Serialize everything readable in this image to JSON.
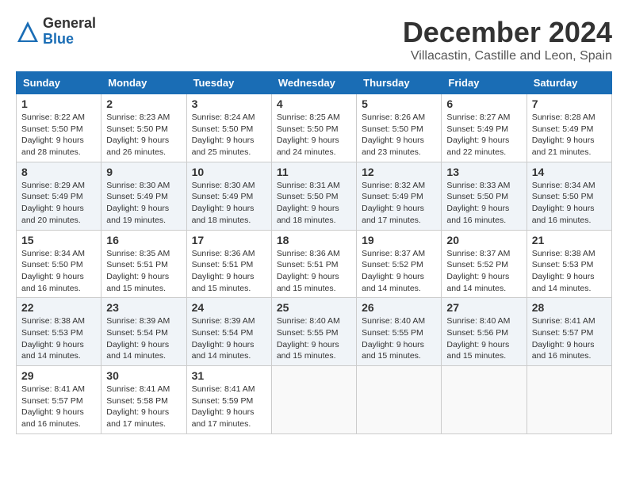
{
  "logo": {
    "general": "General",
    "blue": "Blue"
  },
  "title": "December 2024",
  "location": "Villacastin, Castille and Leon, Spain",
  "weekdays": [
    "Sunday",
    "Monday",
    "Tuesday",
    "Wednesday",
    "Thursday",
    "Friday",
    "Saturday"
  ],
  "weeks": [
    [
      {
        "day": "1",
        "info": "Sunrise: 8:22 AM\nSunset: 5:50 PM\nDaylight: 9 hours and 28 minutes."
      },
      {
        "day": "2",
        "info": "Sunrise: 8:23 AM\nSunset: 5:50 PM\nDaylight: 9 hours and 26 minutes."
      },
      {
        "day": "3",
        "info": "Sunrise: 8:24 AM\nSunset: 5:50 PM\nDaylight: 9 hours and 25 minutes."
      },
      {
        "day": "4",
        "info": "Sunrise: 8:25 AM\nSunset: 5:50 PM\nDaylight: 9 hours and 24 minutes."
      },
      {
        "day": "5",
        "info": "Sunrise: 8:26 AM\nSunset: 5:50 PM\nDaylight: 9 hours and 23 minutes."
      },
      {
        "day": "6",
        "info": "Sunrise: 8:27 AM\nSunset: 5:49 PM\nDaylight: 9 hours and 22 minutes."
      },
      {
        "day": "7",
        "info": "Sunrise: 8:28 AM\nSunset: 5:49 PM\nDaylight: 9 hours and 21 minutes."
      }
    ],
    [
      {
        "day": "8",
        "info": "Sunrise: 8:29 AM\nSunset: 5:49 PM\nDaylight: 9 hours and 20 minutes."
      },
      {
        "day": "9",
        "info": "Sunrise: 8:30 AM\nSunset: 5:49 PM\nDaylight: 9 hours and 19 minutes."
      },
      {
        "day": "10",
        "info": "Sunrise: 8:30 AM\nSunset: 5:49 PM\nDaylight: 9 hours and 18 minutes."
      },
      {
        "day": "11",
        "info": "Sunrise: 8:31 AM\nSunset: 5:50 PM\nDaylight: 9 hours and 18 minutes."
      },
      {
        "day": "12",
        "info": "Sunrise: 8:32 AM\nSunset: 5:49 PM\nDaylight: 9 hours and 17 minutes."
      },
      {
        "day": "13",
        "info": "Sunrise: 8:33 AM\nSunset: 5:50 PM\nDaylight: 9 hours and 16 minutes."
      },
      {
        "day": "14",
        "info": "Sunrise: 8:34 AM\nSunset: 5:50 PM\nDaylight: 9 hours and 16 minutes."
      }
    ],
    [
      {
        "day": "15",
        "info": "Sunrise: 8:34 AM\nSunset: 5:50 PM\nDaylight: 9 hours and 16 minutes."
      },
      {
        "day": "16",
        "info": "Sunrise: 8:35 AM\nSunset: 5:51 PM\nDaylight: 9 hours and 15 minutes."
      },
      {
        "day": "17",
        "info": "Sunrise: 8:36 AM\nSunset: 5:51 PM\nDaylight: 9 hours and 15 minutes."
      },
      {
        "day": "18",
        "info": "Sunrise: 8:36 AM\nSunset: 5:51 PM\nDaylight: 9 hours and 15 minutes."
      },
      {
        "day": "19",
        "info": "Sunrise: 8:37 AM\nSunset: 5:52 PM\nDaylight: 9 hours and 14 minutes."
      },
      {
        "day": "20",
        "info": "Sunrise: 8:37 AM\nSunset: 5:52 PM\nDaylight: 9 hours and 14 minutes."
      },
      {
        "day": "21",
        "info": "Sunrise: 8:38 AM\nSunset: 5:53 PM\nDaylight: 9 hours and 14 minutes."
      }
    ],
    [
      {
        "day": "22",
        "info": "Sunrise: 8:38 AM\nSunset: 5:53 PM\nDaylight: 9 hours and 14 minutes."
      },
      {
        "day": "23",
        "info": "Sunrise: 8:39 AM\nSunset: 5:54 PM\nDaylight: 9 hours and 14 minutes."
      },
      {
        "day": "24",
        "info": "Sunrise: 8:39 AM\nSunset: 5:54 PM\nDaylight: 9 hours and 14 minutes."
      },
      {
        "day": "25",
        "info": "Sunrise: 8:40 AM\nSunset: 5:55 PM\nDaylight: 9 hours and 15 minutes."
      },
      {
        "day": "26",
        "info": "Sunrise: 8:40 AM\nSunset: 5:55 PM\nDaylight: 9 hours and 15 minutes."
      },
      {
        "day": "27",
        "info": "Sunrise: 8:40 AM\nSunset: 5:56 PM\nDaylight: 9 hours and 15 minutes."
      },
      {
        "day": "28",
        "info": "Sunrise: 8:41 AM\nSunset: 5:57 PM\nDaylight: 9 hours and 16 minutes."
      }
    ],
    [
      {
        "day": "29",
        "info": "Sunrise: 8:41 AM\nSunset: 5:57 PM\nDaylight: 9 hours and 16 minutes."
      },
      {
        "day": "30",
        "info": "Sunrise: 8:41 AM\nSunset: 5:58 PM\nDaylight: 9 hours and 17 minutes."
      },
      {
        "day": "31",
        "info": "Sunrise: 8:41 AM\nSunset: 5:59 PM\nDaylight: 9 hours and 17 minutes."
      },
      null,
      null,
      null,
      null
    ]
  ]
}
